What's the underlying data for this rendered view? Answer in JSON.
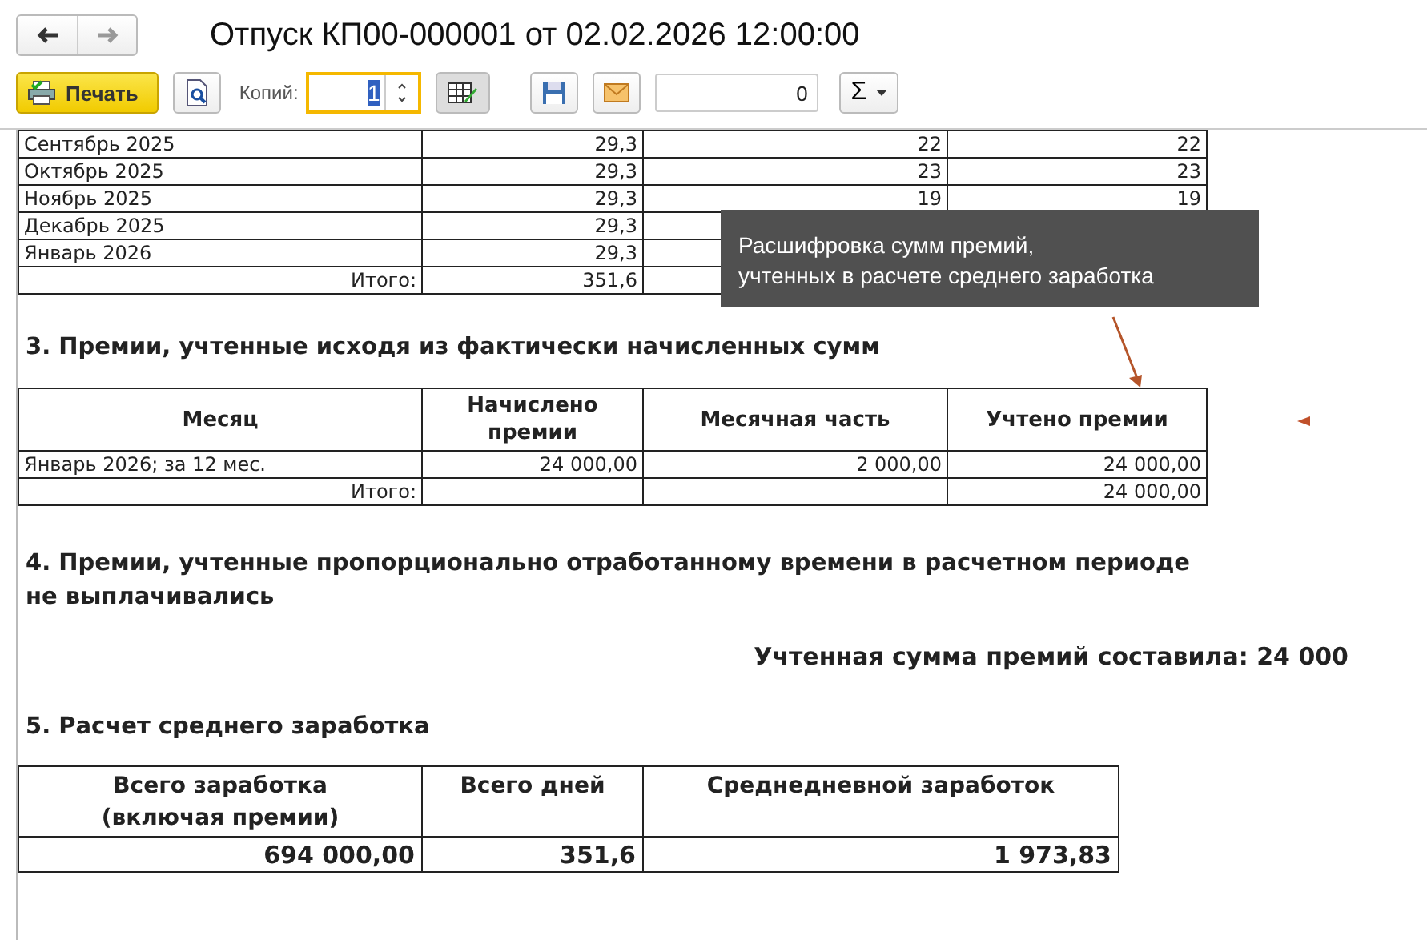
{
  "window": {
    "title": "Отпуск КП00-000001 от 02.02.2026 12:00:00"
  },
  "toolbar": {
    "print_label": "Печать",
    "copies_label": "Копий:",
    "copies_value": "1",
    "counter_value": "0",
    "sum_symbol": "Σ"
  },
  "days_table": {
    "rows": [
      {
        "column_1": "Сентябрь 2025",
        "column_2": "29,3",
        "column_3": "22",
        "column_4": "22"
      },
      {
        "column_1": "Октябрь 2025",
        "column_2": "29,3",
        "column_3": "23",
        "column_4": "23"
      },
      {
        "column_1": "Ноябрь 2025",
        "column_2": "29,3",
        "column_3": "19",
        "column_4": "19"
      },
      {
        "column_1": "Декабрь 2025",
        "column_2": "29,3"
      },
      {
        "column_1": "Январь 2026",
        "column_2": "29,3"
      }
    ],
    "total": {
      "label": "Итого:",
      "column_2": "351,6"
    }
  },
  "tooltip": {
    "lines": [
      "Расшифровка сумм премий,",
      "учтенных в расчете среднего заработка"
    ]
  },
  "section_3": {
    "heading": "3. Премии, учтенные исходя из фактически начисленных сумм",
    "columns": [
      "Месяц",
      "Начислено премии",
      "Месячная часть",
      "Учтено премии"
    ],
    "rows": [
      {
        "month": "Январь 2026; за 12 мес.",
        "accrued": "24 000,00",
        "monthly": "2 000,00",
        "counted": "24 000,00"
      }
    ],
    "total": {
      "label": "Итого:",
      "counted": "24 000,00"
    }
  },
  "section_4": {
    "heading": "4. Премии, учтенные пропорционально отработанному времени в расчетном периоде не выплачивались",
    "summary": "Учтенная сумма премий составила: 24 000"
  },
  "section_5": {
    "heading": "5. Расчет среднего  заработка",
    "columns": [
      "Всего заработка (включая премии)",
      "Всего дней",
      "Среднедневной заработок"
    ],
    "values": [
      "694 000,00",
      "351,6",
      "1 973,83"
    ]
  }
}
